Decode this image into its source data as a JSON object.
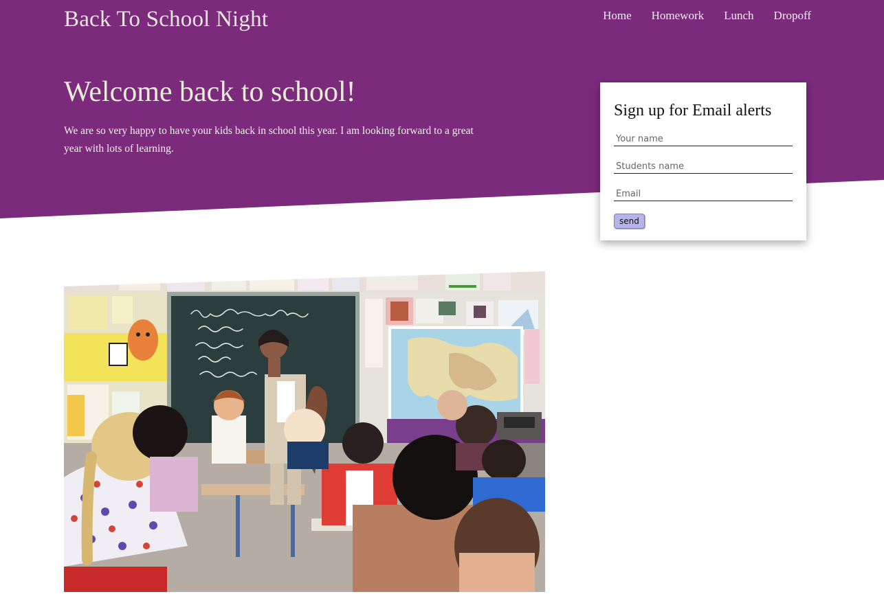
{
  "site": {
    "title": "Back To School Night"
  },
  "nav": {
    "items": [
      "Home",
      "Homework",
      "Lunch",
      "Dropoff"
    ]
  },
  "hero": {
    "headline": "Welcome back to school!",
    "intro": "We are so very happy to have your kids back in school this year. I am looking forward to a great year with lots of learning."
  },
  "signup": {
    "title": "Sign up for Email alerts",
    "name_placeholder": "Your name",
    "student_placeholder": "Students name",
    "email_placeholder": "Email",
    "send_label": "send"
  },
  "colors": {
    "brand": "#7b2a7c",
    "card": "#ffffff",
    "button": "#b7b4ea"
  }
}
